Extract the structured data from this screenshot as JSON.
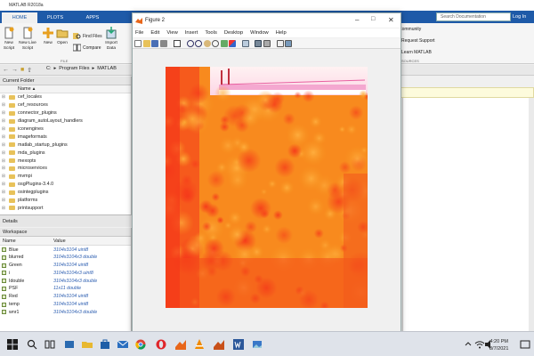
{
  "matlab": {
    "title": "MATLAB R2018a",
    "tabs": [
      "HOME",
      "PLOTS",
      "APPS"
    ],
    "search_placeholder": "Search Documentation",
    "login": "Log In",
    "ribbon": {
      "new_script": "New Script",
      "new_live_script": "New Live Script",
      "new": "New",
      "open": "Open",
      "find_files": "Find Files",
      "compare": "Compare",
      "import_data": "Import Data",
      "section_file": "FILE",
      "community": "Community",
      "request_support": "Request Support",
      "learn_matlab": "Learn MATLAB",
      "section_resources": "SOURCES"
    },
    "address": {
      "c": "C:",
      "program_files": "Program Files",
      "matlab": "MATLAB"
    },
    "current_folder": {
      "header": "Current Folder",
      "col_name": "Name",
      "items": [
        "cef_locales",
        "cef_resources",
        "connector_plugins",
        "diagram_autoLayout_handlers",
        "iconengines",
        "imageformats",
        "matlab_startup_plugins",
        "mda_plugins",
        "mexopts",
        "microservices",
        "mvmpi",
        "osgPlugins-3.4.0",
        "osintegplugins",
        "platforms",
        "printsupport"
      ]
    },
    "details": "Details",
    "workspace": {
      "header": "Workspace",
      "col_name": "Name",
      "col_value": "Value",
      "rows": [
        {
          "name": "Blue",
          "value": "3104x3104 uint8"
        },
        {
          "name": "blurred",
          "value": "3104x3104x3 double"
        },
        {
          "name": "Green",
          "value": "3104x3104 uint8"
        },
        {
          "name": "i",
          "value": "3104x3104x3 uint8"
        },
        {
          "name": "Idouble",
          "value": "3104x3104x3 double"
        },
        {
          "name": "PSF",
          "value": "11x11 double"
        },
        {
          "name": "Red",
          "value": "3104x3104 uint8"
        },
        {
          "name": "temp",
          "value": "3104x3104 uint8"
        },
        {
          "name": "wnr1",
          "value": "3104x3104x3 double"
        }
      ]
    }
  },
  "figure": {
    "title": "Figure 2",
    "menu": [
      "File",
      "Edit",
      "View",
      "Insert",
      "Tools",
      "Desktop",
      "Window",
      "Help"
    ]
  },
  "taskbar": {
    "time": "4:20 PM",
    "date": "8/7/2021"
  },
  "colors": {
    "matlab_blue": "#1e5aa8",
    "photo_orange": "#f7941d",
    "photo_red": "#f5361a"
  }
}
